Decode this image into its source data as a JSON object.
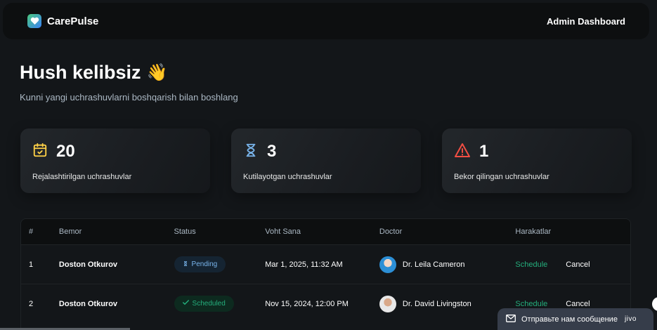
{
  "header": {
    "brand": "CarePulse",
    "admin_link": "Admin Dashboard"
  },
  "welcome": {
    "title": "Hush kelibsiz",
    "emoji": "👋",
    "subtitle": "Kunni yangi uchrashuvlarni boshqarish bilan boshlang"
  },
  "stats": [
    {
      "count": "20",
      "label": "Rejalashtirilgan uchrashuvlar",
      "icon": "calendar-check-icon",
      "color": "#ffd147"
    },
    {
      "count": "3",
      "label": "Kutilayotgan uchrashuvlar",
      "icon": "hourglass-icon",
      "color": "#79b5ec"
    },
    {
      "count": "1",
      "label": "Bekor qilingan uchrashuvlar",
      "icon": "warning-icon",
      "color": "#f24e43"
    }
  ],
  "table": {
    "headers": [
      "#",
      "Bemor",
      "Status",
      "Voht Sana",
      "Doctor",
      "Harakatlar"
    ],
    "rows": [
      {
        "num": "1",
        "patient": "Doston Otkurov",
        "status": "Pending",
        "date": "Mar 1, 2025, 11:32 AM",
        "doctor": "Dr. Leila Cameron",
        "schedule": "Schedule",
        "cancel": "Cancel"
      },
      {
        "num": "2",
        "patient": "Doston Otkurov",
        "status": "Scheduled",
        "date": "Nov 15, 2024, 12:00 PM",
        "doctor": "Dr. David Livingston",
        "schedule": "Schedule",
        "cancel": "Cancel"
      }
    ]
  },
  "chat_widget": {
    "text": "Отправьте нам сообщение",
    "brand": "jivo"
  },
  "colors": {
    "background": "#131619",
    "green": "#24ae7c",
    "blue": "#79b5ec",
    "red": "#f24e43",
    "yellow": "#ffd147"
  }
}
